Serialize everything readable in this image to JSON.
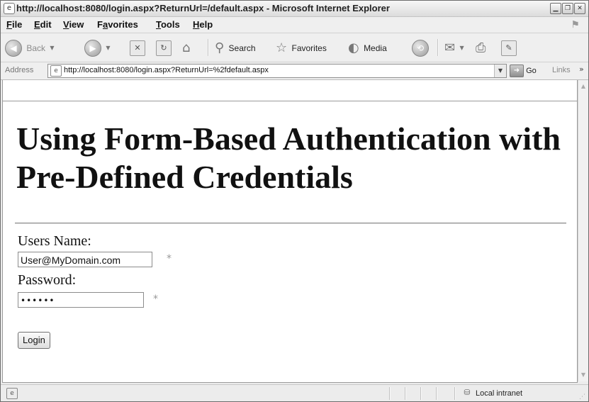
{
  "window": {
    "title": "http://localhost:8080/login.aspx?ReturnUrl=/default.aspx - Microsoft Internet Explorer",
    "controls": [
      "minimize-icon",
      "restore-icon",
      "close-icon"
    ]
  },
  "menu": {
    "items": [
      {
        "accel": "F",
        "rest": "ile"
      },
      {
        "accel": "E",
        "rest": "dit"
      },
      {
        "accel": "V",
        "rest": "iew"
      },
      {
        "pre": "F",
        "accel": "a",
        "rest": "vorites"
      },
      {
        "accel": "T",
        "rest": "ools"
      },
      {
        "accel": "H",
        "rest": "elp"
      }
    ]
  },
  "toolbar": {
    "back_label": "Back",
    "search_label": "Search",
    "favorites_label": "Favorites",
    "media_label": "Media"
  },
  "address": {
    "label": "Address",
    "url": "http://localhost:8080/login.aspx?ReturnUrl=%2fdefault.aspx",
    "go_label": "Go",
    "links_label": "Links",
    "links_more": "»"
  },
  "page": {
    "heading": "Using Form-Based Authentication with Pre-Defined Credentials",
    "username_label": "Users Name:",
    "username_value": "User@MyDomain.com",
    "username_required": "*",
    "password_label": "Password:",
    "password_masked": "••••••",
    "password_required": "*",
    "login_button": "Login"
  },
  "status": {
    "zone": "Local intranet"
  },
  "colors": {
    "window_chrome": "#ececec",
    "page_background": "#ffffff",
    "text": "#111111"
  }
}
